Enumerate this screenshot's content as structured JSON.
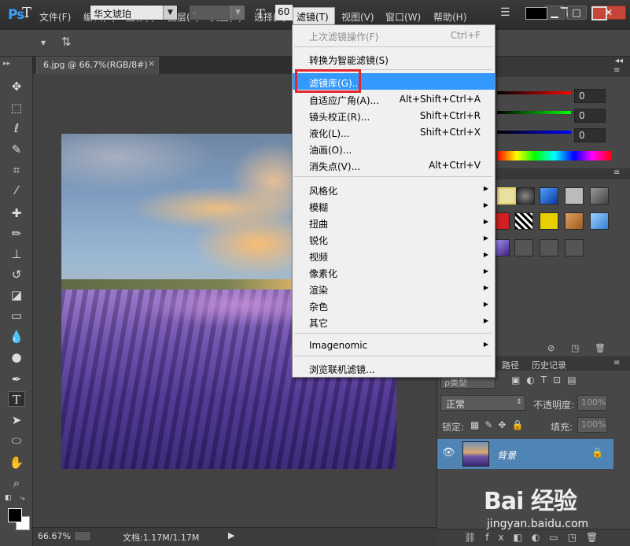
{
  "app": {
    "logo": "Ps",
    "menus": [
      "文件(F)",
      "编辑(E)",
      "图像(I)",
      "图层(L)",
      "类型(Y)",
      "选择(S)",
      "滤镜(T)",
      "视图(V)",
      "窗口(W)",
      "帮助(H)"
    ],
    "window_buttons": {
      "minimize": "▁",
      "maximize": "□",
      "close": "✕"
    }
  },
  "options": {
    "tool_glyph": "T",
    "font_family": "华文琥珀",
    "font_style": "-",
    "font_size_icon": "T",
    "font_size": "60",
    "dropdown_arrow": "▼"
  },
  "document": {
    "tab_title": "6.jpg @ 66.7%(RGB/8#)",
    "tab_close": "×",
    "zoom": "66.67%",
    "doc_info": "文档:1.17M/1.17M",
    "status_arrow": "▶"
  },
  "filter_menu": {
    "items": [
      {
        "label": "上次滤镜操作(F)",
        "shortcut": "Ctrl+F",
        "disabled": true
      },
      {
        "label": "转换为智能滤镜(S)",
        "shortcut": ""
      },
      {
        "label": "滤镜库(G)...",
        "shortcut": "",
        "highlighted": true
      },
      {
        "label": "自适应广角(A)...",
        "shortcut": "Alt+Shift+Ctrl+A"
      },
      {
        "label": "镜头校正(R)...",
        "shortcut": "Shift+Ctrl+R"
      },
      {
        "label": "液化(L)...",
        "shortcut": "Shift+Ctrl+X"
      },
      {
        "label": "油画(O)...",
        "shortcut": ""
      },
      {
        "label": "消失点(V)...",
        "shortcut": "Alt+Ctrl+V"
      },
      {
        "label": "风格化",
        "submenu": true
      },
      {
        "label": "模糊",
        "submenu": true
      },
      {
        "label": "扭曲",
        "submenu": true
      },
      {
        "label": "锐化",
        "submenu": true
      },
      {
        "label": "视频",
        "submenu": true
      },
      {
        "label": "像素化",
        "submenu": true
      },
      {
        "label": "渲染",
        "submenu": true
      },
      {
        "label": "杂色",
        "submenu": true
      },
      {
        "label": "其它",
        "submenu": true
      },
      {
        "label": "Imagenomic",
        "submenu": true
      },
      {
        "label": "浏览联机滤镜..."
      }
    ],
    "submenu_arrow": "▶"
  },
  "color_panel": {
    "values": [
      "0",
      "0",
      "0"
    ]
  },
  "layers_panel": {
    "tabs": [
      "路径",
      "历史记录"
    ],
    "kind_filter": "ρ类型",
    "blend_mode": "正常",
    "opacity_label": "不透明度:",
    "opacity_value": "100%",
    "lock_label": "锁定:",
    "fill_label": "填充:",
    "fill_value": "100%",
    "layer_name": "背景",
    "layer_lock": "🔒",
    "eye": "👁"
  },
  "watermark": {
    "logo": "Bai 经验",
    "url": "jingyan.baidu.com"
  },
  "colors": {
    "highlight": "#3399ff",
    "red_box": "#e3262a",
    "layer_selected": "#4f84b4"
  }
}
